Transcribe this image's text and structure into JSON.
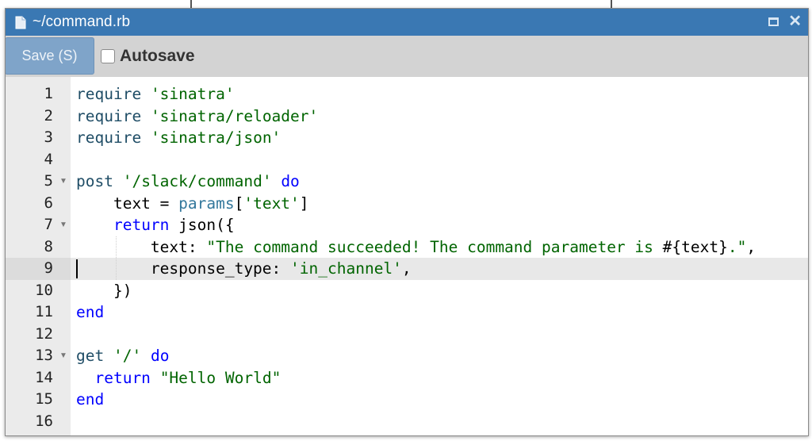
{
  "window": {
    "title": "~/command.rb",
    "file_icon": "file-icon",
    "maximize_icon": "maximize-icon",
    "close_icon": "close-icon",
    "close_glyph": "✕",
    "title_bar_color": "#3a78b3"
  },
  "toolbar": {
    "save_label": "Save (S)",
    "autosave_label": "Autosave",
    "autosave_checked": false
  },
  "editor": {
    "active_line": 9,
    "lines": [
      {
        "num": "1",
        "fold": false,
        "tokens": [
          {
            "t": "require",
            "c": "id"
          },
          {
            "t": " ",
            "c": "plain"
          },
          {
            "t": "'sinatra'",
            "c": "str"
          }
        ]
      },
      {
        "num": "2",
        "fold": false,
        "tokens": [
          {
            "t": "require",
            "c": "id"
          },
          {
            "t": " ",
            "c": "plain"
          },
          {
            "t": "'sinatra/reloader'",
            "c": "str"
          }
        ]
      },
      {
        "num": "3",
        "fold": false,
        "tokens": [
          {
            "t": "require",
            "c": "id"
          },
          {
            "t": " ",
            "c": "plain"
          },
          {
            "t": "'sinatra/json'",
            "c": "str"
          }
        ]
      },
      {
        "num": "4",
        "fold": false,
        "tokens": []
      },
      {
        "num": "5",
        "fold": true,
        "tokens": [
          {
            "t": "post",
            "c": "id"
          },
          {
            "t": " ",
            "c": "plain"
          },
          {
            "t": "'/slack/command'",
            "c": "str"
          },
          {
            "t": " ",
            "c": "plain"
          },
          {
            "t": "do",
            "c": "kw"
          }
        ]
      },
      {
        "num": "6",
        "fold": false,
        "tokens": [
          {
            "t": "    text = ",
            "c": "plain"
          },
          {
            "t": "params",
            "c": "var"
          },
          {
            "t": "[",
            "c": "plain"
          },
          {
            "t": "'text'",
            "c": "str"
          },
          {
            "t": "]",
            "c": "plain"
          }
        ]
      },
      {
        "num": "7",
        "fold": true,
        "tokens": [
          {
            "t": "    ",
            "c": "plain"
          },
          {
            "t": "return",
            "c": "kw"
          },
          {
            "t": " json({",
            "c": "plain"
          }
        ]
      },
      {
        "num": "8",
        "fold": false,
        "tokens": [
          {
            "t": "        text: ",
            "c": "plain"
          },
          {
            "t": "\"The command succeeded! The command parameter is ",
            "c": "str"
          },
          {
            "t": "#{text}",
            "c": "plain"
          },
          {
            "t": ".\"",
            "c": "str"
          },
          {
            "t": ",",
            "c": "plain"
          }
        ]
      },
      {
        "num": "9",
        "fold": false,
        "tokens": [
          {
            "t": "        response_type: ",
            "c": "plain"
          },
          {
            "t": "'in_channel'",
            "c": "str"
          },
          {
            "t": ",",
            "c": "plain"
          }
        ]
      },
      {
        "num": "10",
        "fold": false,
        "tokens": [
          {
            "t": "    })",
            "c": "plain"
          }
        ]
      },
      {
        "num": "11",
        "fold": false,
        "tokens": [
          {
            "t": "end",
            "c": "kw"
          }
        ]
      },
      {
        "num": "12",
        "fold": false,
        "tokens": []
      },
      {
        "num": "13",
        "fold": true,
        "tokens": [
          {
            "t": "get",
            "c": "id"
          },
          {
            "t": " ",
            "c": "plain"
          },
          {
            "t": "'/'",
            "c": "str"
          },
          {
            "t": " ",
            "c": "plain"
          },
          {
            "t": "do",
            "c": "kw"
          }
        ]
      },
      {
        "num": "14",
        "fold": false,
        "tokens": [
          {
            "t": "  ",
            "c": "plain"
          },
          {
            "t": "return",
            "c": "kw"
          },
          {
            "t": " ",
            "c": "plain"
          },
          {
            "t": "\"Hello World\"",
            "c": "str"
          }
        ]
      },
      {
        "num": "15",
        "fold": false,
        "tokens": [
          {
            "t": "end",
            "c": "kw"
          }
        ]
      },
      {
        "num": "16",
        "fold": false,
        "tokens": []
      }
    ]
  }
}
